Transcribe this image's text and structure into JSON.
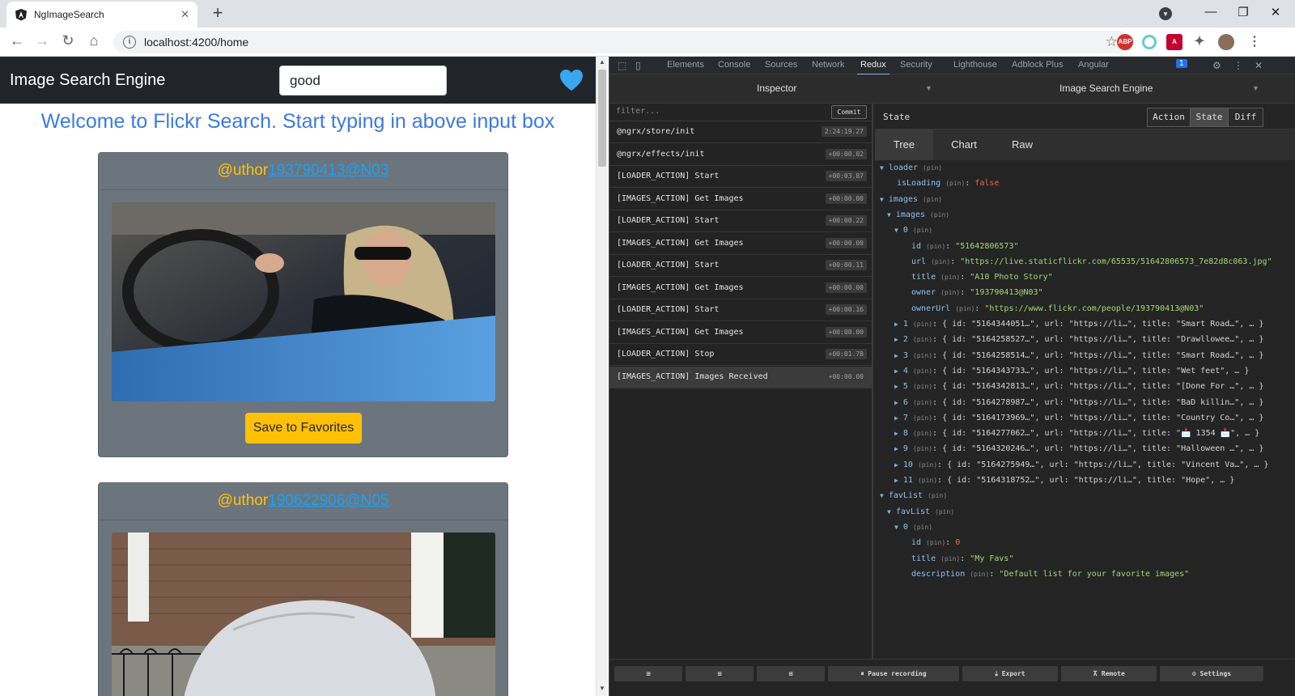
{
  "browser": {
    "tab_title": "NgImageSearch",
    "url": "localhost:4200/home",
    "extensions": [
      "ABP",
      "A"
    ]
  },
  "app": {
    "brand": "Image Search Engine",
    "search_value": "good",
    "welcome": "Welcome to Flickr Search. Start typing in above input box",
    "cards": [
      {
        "prefix": "@uthor",
        "owner": "193790413@N03",
        "button": "Save to Favorites"
      },
      {
        "prefix": "@uthor",
        "owner": "190622906@N05"
      }
    ]
  },
  "devtools": {
    "tabs": [
      "Elements",
      "Console",
      "Sources",
      "Network",
      "Redux",
      "Security",
      "Lighthouse",
      "Adblock Plus",
      "Angular"
    ],
    "active_tab": "Redux",
    "issues_count": "1",
    "inspector_title": "Inspector",
    "monitor_title": "Image Search Engine",
    "filter_placeholder": "filter...",
    "commit_label": "Commit",
    "actions": [
      {
        "name": "@ngrx/store/init",
        "time": "2:24:19.27"
      },
      {
        "name": "@ngrx/effects/init",
        "time": "+00:00.02"
      },
      {
        "name": "[LOADER_ACTION] Start",
        "time": "+00:03.87"
      },
      {
        "name": "[IMAGES_ACTION] Get Images",
        "time": "+00:00.00"
      },
      {
        "name": "[LOADER_ACTION] Start",
        "time": "+00:00.22"
      },
      {
        "name": "[IMAGES_ACTION] Get Images",
        "time": "+00:00.00"
      },
      {
        "name": "[LOADER_ACTION] Start",
        "time": "+00:00.11"
      },
      {
        "name": "[IMAGES_ACTION] Get Images",
        "time": "+00:00.00"
      },
      {
        "name": "[LOADER_ACTION] Start",
        "time": "+00:00.16"
      },
      {
        "name": "[IMAGES_ACTION] Get Images",
        "time": "+00:00.00"
      },
      {
        "name": "[LOADER_ACTION] Stop",
        "time": "+00:01.78"
      },
      {
        "name": "[IMAGES_ACTION] Images Received",
        "time": "+00:00.00"
      }
    ],
    "selected_action_index": 11,
    "state_label": "State",
    "segments": [
      "Action",
      "State",
      "Diff"
    ],
    "active_segment": "State",
    "view_tabs": [
      "Tree",
      "Chart",
      "Raw"
    ],
    "active_view": "Tree",
    "pin": "(pin)",
    "tree": [
      {
        "indent": 0,
        "twisty": "▼",
        "key": "loader",
        "pin": true
      },
      {
        "indent": 1,
        "key": "isLoading",
        "pin": true,
        "colon": ": ",
        "val": "false",
        "vtype": "f"
      },
      {
        "indent": 0,
        "twisty": "▼",
        "key": "images",
        "pin": true
      },
      {
        "indent": 1,
        "twisty": "▼",
        "key": "images",
        "pin": true
      },
      {
        "indent": 2,
        "twisty": "▼",
        "key": "0",
        "pin": true
      },
      {
        "indent": 3,
        "key": "id",
        "pin": true,
        "colon": ": ",
        "val": "\"51642806573\"",
        "vtype": "s"
      },
      {
        "indent": 3,
        "key": "url",
        "pin": true,
        "colon": ": ",
        "val": "\"https://live.staticflickr.com/65535/51642806573_7e82d8c063.jpg\"",
        "vtype": "s"
      },
      {
        "indent": 3,
        "key": "title",
        "pin": true,
        "colon": ": ",
        "val": "\"A10 Photo Story\"",
        "vtype": "s"
      },
      {
        "indent": 3,
        "key": "owner",
        "pin": true,
        "colon": ": ",
        "val": "\"193790413@N03\"",
        "vtype": "s"
      },
      {
        "indent": 3,
        "key": "ownerUrl",
        "pin": true,
        "colon": ": ",
        "val": "\"https://www.flickr.com/people/193790413@N03\"",
        "vtype": "s"
      },
      {
        "indent": 2,
        "twisty": "▶",
        "key": "1",
        "pin": true,
        "colon": ": ",
        "val": "{ id: \"5164344051…\", url: \"https://li…\", title: \"Smart Road…\", … }",
        "vtype": "p"
      },
      {
        "indent": 2,
        "twisty": "▶",
        "key": "2",
        "pin": true,
        "colon": ": ",
        "val": "{ id: \"5164258527…\", url: \"https://li…\", title: \"Drawllowee…\", … }",
        "vtype": "p"
      },
      {
        "indent": 2,
        "twisty": "▶",
        "key": "3",
        "pin": true,
        "colon": ": ",
        "val": "{ id: \"5164258514…\", url: \"https://li…\", title: \"Smart Road…\", … }",
        "vtype": "p"
      },
      {
        "indent": 2,
        "twisty": "▶",
        "key": "4",
        "pin": true,
        "colon": ": ",
        "val": "{ id: \"5164343733…\", url: \"https://li…\", title: \"Wet feet\", … }",
        "vtype": "p"
      },
      {
        "indent": 2,
        "twisty": "▶",
        "key": "5",
        "pin": true,
        "colon": ": ",
        "val": "{ id: \"5164342813…\", url: \"https://li…\", title: \"[Done For …\", … }",
        "vtype": "p"
      },
      {
        "indent": 2,
        "twisty": "▶",
        "key": "6",
        "pin": true,
        "colon": ": ",
        "val": "{ id: \"5164278987…\", url: \"https://li…\", title: \"BaD killin…\", … }",
        "vtype": "p"
      },
      {
        "indent": 2,
        "twisty": "▶",
        "key": "7",
        "pin": true,
        "colon": ": ",
        "val": "{ id: \"5164173969…\", url: \"https://li…\", title: \"Country Co…\", … }",
        "vtype": "p"
      },
      {
        "indent": 2,
        "twisty": "▶",
        "key": "8",
        "pin": true,
        "colon": ": ",
        "val": "{ id: \"5164277062…\", url: \"https://li…\", title: \"📩 1354 📩\", … }",
        "vtype": "p"
      },
      {
        "indent": 2,
        "twisty": "▶",
        "key": "9",
        "pin": true,
        "colon": ": ",
        "val": "{ id: \"5164320246…\", url: \"https://li…\", title: \"Halloween …\", … }",
        "vtype": "p"
      },
      {
        "indent": 2,
        "twisty": "▶",
        "key": "10",
        "pin": true,
        "colon": ": ",
        "val": "{ id: \"5164275949…\", url: \"https://li…\", title: \"Vincent Va…\", … }",
        "vtype": "p"
      },
      {
        "indent": 2,
        "twisty": "▶",
        "key": "11",
        "pin": true,
        "colon": ": ",
        "val": "{ id: \"5164318752…\", url: \"https://li…\", title: \"Hope\", … }",
        "vtype": "p"
      },
      {
        "indent": 0,
        "twisty": "▼",
        "key": "favList",
        "pin": true
      },
      {
        "indent": 1,
        "twisty": "▼",
        "key": "favList",
        "pin": true
      },
      {
        "indent": 2,
        "twisty": "▼",
        "key": "0",
        "pin": true
      },
      {
        "indent": 3,
        "key": "id",
        "pin": true,
        "colon": ": ",
        "val": "0",
        "vtype": "n"
      },
      {
        "indent": 3,
        "key": "title",
        "pin": true,
        "colon": ": ",
        "val": "\"My Favs\"",
        "vtype": "s"
      },
      {
        "indent": 3,
        "key": "description",
        "pin": true,
        "colon": ": ",
        "val": "\"Default list for your favorite images\"",
        "vtype": "s"
      }
    ],
    "footer": {
      "pause": "Pause recording",
      "export": "Export",
      "remote": "Remote",
      "settings": "Settings"
    }
  },
  "colors": {
    "accent": "#3d7ae0",
    "warning": "#ffc107",
    "heart": "#3aa6ee"
  }
}
